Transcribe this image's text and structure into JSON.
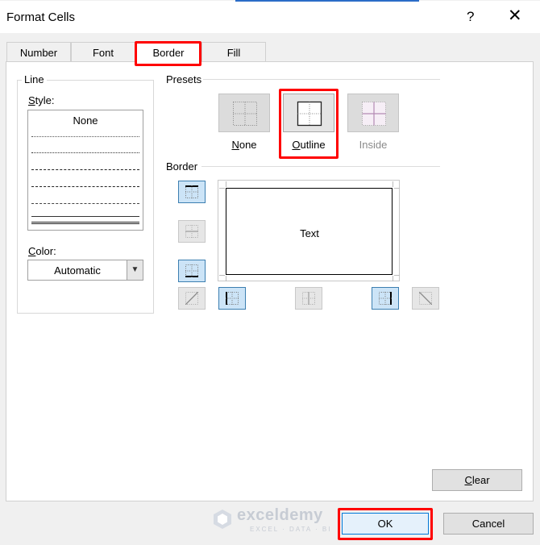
{
  "window": {
    "title": "Format Cells",
    "help_glyph": "?",
    "close_glyph": "✕"
  },
  "tabs": [
    {
      "label": "Number",
      "active": false
    },
    {
      "label": "Font",
      "active": false
    },
    {
      "label": "Border",
      "active": true
    },
    {
      "label": "Fill",
      "active": false
    }
  ],
  "line": {
    "group_label": "Line",
    "style_label": "Style:",
    "style_options": [
      "None"
    ],
    "color_label": "Color:",
    "color_value": "Automatic"
  },
  "presets": {
    "section_label": "Presets",
    "items": [
      {
        "label": "None",
        "enabled": true
      },
      {
        "label": "Outline",
        "enabled": true,
        "selected": true
      },
      {
        "label": "Inside",
        "enabled": false
      }
    ]
  },
  "border": {
    "section_label": "Border",
    "preview_text": "Text",
    "buttons": [
      {
        "name": "border-top-button",
        "on": true,
        "icon": "border-top-icon"
      },
      {
        "name": "border-inside-horizontal-button",
        "on": false,
        "icon": "border-inside-horizontal-icon"
      },
      {
        "name": "border-bottom-button",
        "on": true,
        "icon": "border-bottom-icon"
      },
      {
        "name": "border-diagonal-up-button",
        "on": false,
        "icon": "diagonal-up-icon"
      },
      {
        "name": "border-left-button",
        "on": true,
        "icon": "border-left-icon"
      },
      {
        "name": "border-inside-vertical-button",
        "on": false,
        "icon": "border-inside-vertical-icon"
      },
      {
        "name": "border-right-button",
        "on": true,
        "icon": "border-right-icon"
      },
      {
        "name": "border-diagonal-down-button",
        "on": false,
        "icon": "diagonal-down-icon"
      }
    ]
  },
  "buttons": {
    "clear": "Clear",
    "ok": "OK",
    "cancel": "Cancel"
  },
  "watermark": {
    "name": "exceldemy",
    "tagline": "EXCEL · DATA · BI"
  },
  "colors": {
    "highlight": "#ff0000",
    "selected_border_button": "#cce4f7",
    "accent": "#0078d7"
  }
}
